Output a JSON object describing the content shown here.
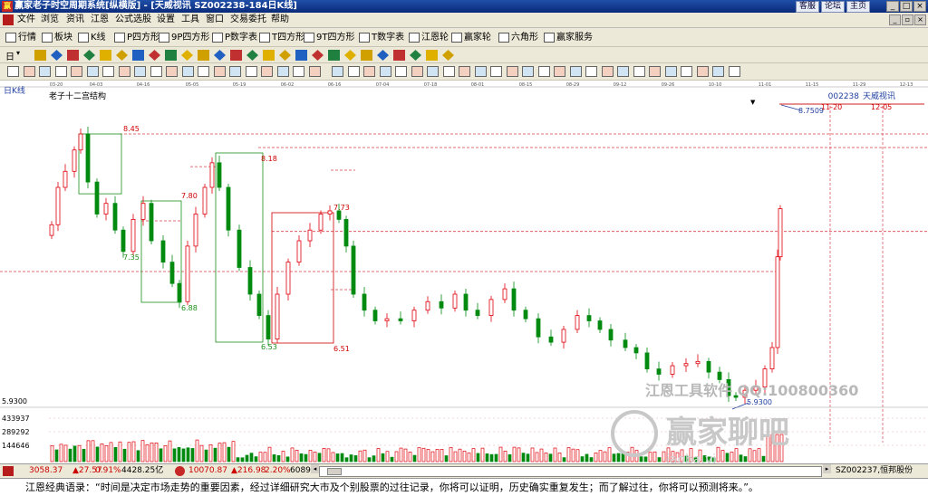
{
  "window": {
    "title": "赢家老子时空周期系统[纵横版] - [天威视讯  SZ002238-184日K线]",
    "links": [
      "客服",
      "论坛",
      "主页"
    ],
    "controls": [
      "_",
      "□",
      "×"
    ]
  },
  "menu": [
    "文件",
    "浏览",
    "资讯",
    "江恩",
    "公式选股",
    "设置",
    "工具",
    "窗口",
    "交易委托",
    "帮助"
  ],
  "toolbar1": [
    {
      "label": "行情",
      "icon": "quote-grid-icon"
    },
    {
      "label": "板块",
      "icon": "sector-icon"
    },
    {
      "label": "K线",
      "icon": "kline-icon"
    },
    {
      "label": "P四方形",
      "icon": "square-p-icon"
    },
    {
      "label": "9P四方形",
      "icon": "square-9p-icon"
    },
    {
      "label": "P数字表",
      "icon": "number-p-icon"
    },
    {
      "label": "T四方形",
      "icon": "square-t-icon"
    },
    {
      "label": "9T四方形",
      "icon": "square-9t-icon"
    },
    {
      "label": "T数字表",
      "icon": "number-t-icon"
    },
    {
      "label": "江恩轮",
      "icon": "gann-wheel-icon"
    },
    {
      "label": "赢家轮",
      "icon": "winner-wheel-icon"
    },
    {
      "label": "六角形",
      "icon": "hexagon-icon"
    },
    {
      "label": "赢家服务",
      "icon": "service-icon"
    }
  ],
  "toolbar2": {
    "period": "日",
    "icons_count": 26
  },
  "chart": {
    "period_label": "日K线",
    "indicator_label": "老子十二宫结构",
    "stock_code": "002238",
    "stock_name": "天威视讯",
    "date_ticks": [
      "03-20",
      "04-03",
      "04-16",
      "05-05",
      "05-19",
      "06-02",
      "06-16",
      "07-04",
      "07-18",
      "08-01",
      "08-15",
      "08-29",
      "09-12",
      "09-26",
      "10-10",
      "11-01",
      "11-15",
      "11-29",
      "12-13"
    ],
    "price_labels": [
      "8.45",
      "8.18",
      "7.80",
      "7.73",
      "7.35",
      "6.88",
      "6.53",
      "6.51",
      "8.7509",
      "11-20",
      "12-05",
      "5.9300"
    ],
    "axis_price": "5.9300",
    "vol_ticks": [
      "433937",
      "289292",
      "144646"
    ],
    "watermark": [
      "江恩工具软件 QQ:100800360",
      "赢家聊吧",
      "iaoba.yj"
    ],
    "colors": {
      "up": "#e0000a",
      "down": "#008a10",
      "box_green": "#1a8f1a",
      "box_red": "#d00000",
      "dash": "#d8404a"
    }
  },
  "status": {
    "index1_value": "3058.37",
    "index1_change": "▲27.57",
    "index1_pct": "0.91%",
    "index1_amount": "4428.25亿",
    "index2_value": "10070.87",
    "index2_change": "▲216.98",
    "index2_pct": "2.20%",
    "index2_amount": "6089.1",
    "right_stock": "SZ002237,恒邦股份"
  },
  "quote": "江恩经典语录：“时间是决定市场走势的重要因素，经过详细研究大市及个别股票的过往记录，你将可以证明，历史确实重复发生；而了解过往，你将可以预测将来。”。"
}
